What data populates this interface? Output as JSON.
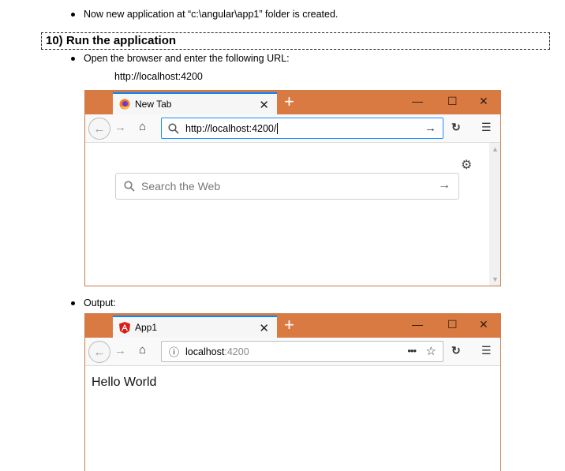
{
  "doc": {
    "line1": "Now new application at “c:\\angular\\app1” folder is created.",
    "heading": "10) Run the application",
    "bullet2": "Open the browser and enter the following URL:",
    "url": "http://localhost:4200",
    "bullet3": "Output:"
  },
  "browser1": {
    "tab_title": "New Tab",
    "url_value": "http://localhost:4200/",
    "search_placeholder": "Search the Web"
  },
  "browser2": {
    "tab_title": "App1",
    "url_host": "localhost",
    "url_port": ":4200",
    "page_content": "Hello World"
  },
  "colors": {
    "titlebar": "#d97a43",
    "tab_accent": "#0a84ff"
  },
  "icons": [
    "firefox-icon",
    "angular-icon",
    "back-icon",
    "forward-icon",
    "home-icon",
    "search-icon",
    "go-arrow-icon",
    "reload-icon",
    "menu-icon",
    "gear-icon",
    "info-icon",
    "star-icon",
    "more-icon"
  ]
}
